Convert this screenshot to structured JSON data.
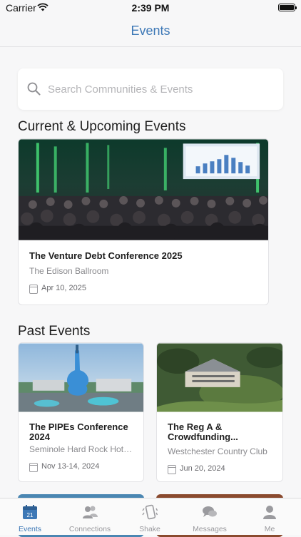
{
  "status_bar": {
    "carrier": "Carrier",
    "time": "2:39 PM"
  },
  "nav": {
    "title": "Events"
  },
  "search": {
    "placeholder": "Search Communities & Events"
  },
  "sections": {
    "current_title": "Current & Upcoming Events",
    "past_title": "Past Events"
  },
  "current_events": [
    {
      "title": "The Venture Debt Conference 2025",
      "venue": "The Edison Ballroom",
      "date": "Apr 10, 2025"
    }
  ],
  "past_events": [
    {
      "title": "The PIPEs Conference 2024",
      "venue": "Seminole Hard Rock Hotel ...",
      "date": "Nov 13-14, 2024"
    },
    {
      "title": "The Reg A & Crowdfunding...",
      "venue": "Westchester Country Club",
      "date": "Jun 20, 2024"
    }
  ],
  "tabs": [
    {
      "label": "Events",
      "active": true,
      "icon": "calendar-icon",
      "badge": "21"
    },
    {
      "label": "Connections",
      "active": false,
      "icon": "people-icon"
    },
    {
      "label": "Shake",
      "active": false,
      "icon": "phone-shake-icon"
    },
    {
      "label": "Messages",
      "active": false,
      "icon": "chat-bubbles-icon"
    },
    {
      "label": "Me",
      "active": false,
      "icon": "person-icon"
    }
  ],
  "colors": {
    "accent": "#3d78b6",
    "background": "#f7f7f8",
    "inactive_tab": "#9a9a9e"
  }
}
